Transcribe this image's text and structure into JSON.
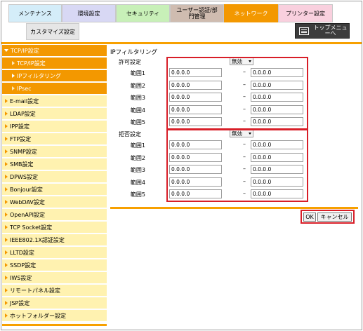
{
  "tabs": [
    {
      "label": "メンテナンス",
      "bg": "#d4edf9"
    },
    {
      "label": "環境設定",
      "bg": "#d8d8f4"
    },
    {
      "label": "セキュリティ",
      "bg": "#c8f0b8"
    },
    {
      "label": "ユーザー認証/部門管理",
      "bg": "#cfbcb0"
    },
    {
      "label": "ネットワーク",
      "bg": "#f39800"
    },
    {
      "label": "プリンター設定",
      "bg": "#f9d0de"
    }
  ],
  "subtab": "カスタマイズ設定",
  "topmenu": "トップメニューへ",
  "sidebar": {
    "active_group": "TCP/IP設定",
    "sub_items": [
      "TCP/IP設定",
      "IPフィルタリング",
      "IPsec"
    ],
    "items": [
      "E-mail設定",
      "LDAP設定",
      "IPP設定",
      "FTP設定",
      "SNMP設定",
      "SMB設定",
      "DPWS設定",
      "Bonjour設定",
      "WebDAV設定",
      "OpenAPI設定",
      "TCP Socket設定",
      "IEEE802.1X認証設定",
      "LLTD設定",
      "SSDP設定",
      "IWS設定",
      "リモートパネル設定",
      "JSP設定",
      "ホットフォルダー設定"
    ]
  },
  "main": {
    "title": "IPフィルタリング",
    "allow": {
      "label": "許可設定",
      "select": "無効",
      "ranges": [
        {
          "label": "範囲1",
          "from": "0.0.0.0",
          "to": "0.0.0.0"
        },
        {
          "label": "範囲2",
          "from": "0.0.0.0",
          "to": "0.0.0.0"
        },
        {
          "label": "範囲3",
          "from": "0.0.0.0",
          "to": "0.0.0.0"
        },
        {
          "label": "範囲4",
          "from": "0.0.0.0",
          "to": "0.0.0.0"
        },
        {
          "label": "範囲5",
          "from": "0.0.0.0",
          "to": "0.0.0.0"
        }
      ]
    },
    "deny": {
      "label": "拒否設定",
      "select": "無効",
      "ranges": [
        {
          "label": "範囲1",
          "from": "0.0.0.0",
          "to": "0.0.0.0"
        },
        {
          "label": "範囲2",
          "from": "0.0.0.0",
          "to": "0.0.0.0"
        },
        {
          "label": "範囲3",
          "from": "0.0.0.0",
          "to": "0.0.0.0"
        },
        {
          "label": "範囲4",
          "from": "0.0.0.0",
          "to": "0.0.0.0"
        },
        {
          "label": "範囲5",
          "from": "0.0.0.0",
          "to": "0.0.0.0"
        }
      ]
    },
    "dash": "–",
    "ok": "OK",
    "cancel": "キャンセル"
  },
  "colors": {
    "accent": "#f39800",
    "sidebar_item_bg": "#fff2b0",
    "sidebar_sub_bg": "#f39800",
    "highlight_red": "#d81e28"
  }
}
